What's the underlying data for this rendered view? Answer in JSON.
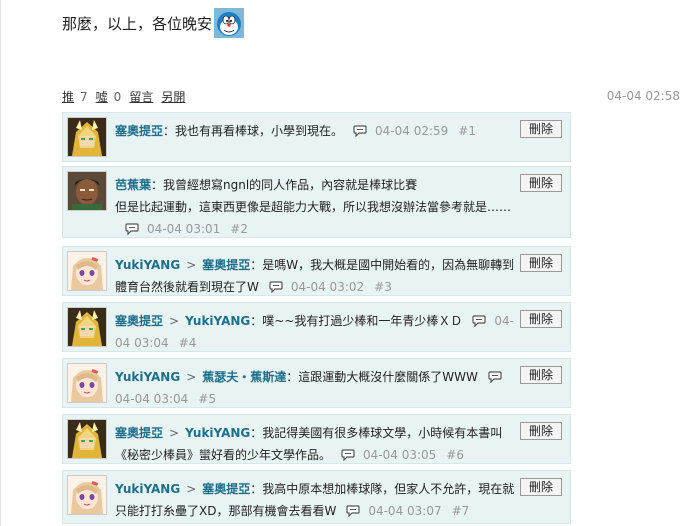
{
  "article_end_text": "那麼，以上，各位晚安",
  "stats": {
    "push_label": "推",
    "push_count": "7",
    "boo_label": "噓",
    "boo_count": "0",
    "comment_label": "留言",
    "newwin_label": "另開",
    "post_time": "04-04 02:58"
  },
  "delete_label": "刪除",
  "comments": [
    {
      "author": "塞奧提亞",
      "text": "：我也有再看棒球，小學到現在。",
      "line2": "",
      "time": "04-04 02:59",
      "floor": "#1",
      "avatar": "gold"
    },
    {
      "author": "芭蕉葉",
      "text": "：我曾經想寫ngnl的同人作品，內容就是棒球比賽",
      "line2": "但是比起運動，這東西更像是超能力大戰，所以我想沒辦法當參考就是……",
      "time": "04-04 03:01",
      "floor": "#2",
      "avatar": "dark"
    },
    {
      "author": "YukiYANG",
      "to": "塞奧提亞",
      "text": "：是嗎W，我大概是國中開始看的，因為無聊轉到",
      "line2": "體育台然後就看到現在了W",
      "time": "04-04 03:02",
      "floor": "#3",
      "avatar": "girl"
    },
    {
      "author": "塞奧提亞",
      "to": "YukiYANG",
      "text": "：噗~~我有打過少棒和一年青少棒ＸＤ",
      "line2": "",
      "time": "04-04 03:04",
      "floor": "#4",
      "avatar": "gold"
    },
    {
      "author": "YukiYANG",
      "to": "蕉瑟夫・蕉斯達",
      "text": "：這跟運動大概沒什麼關係了WWW",
      "line2": "",
      "time": "04-04 03:04",
      "floor": "#5",
      "avatar": "girl"
    },
    {
      "author": "塞奧提亞",
      "to": "YukiYANG",
      "text": "：我記得美國有很多棒球文學，小時候有本書叫",
      "line2": "《秘密少棒員》蠻好看的少年文學作品。",
      "time": "04-04 03:05",
      "floor": "#6",
      "avatar": "gold"
    },
    {
      "author": "YukiYANG",
      "to": "塞奧提亞",
      "text": "：我高中原本想加棒球隊，但家人不允許，現在就",
      "line2": "只能打打糸壘了XD，那部有機會去看看W",
      "time": "04-04 03:07",
      "floor": "#7",
      "avatar": "girl"
    }
  ]
}
